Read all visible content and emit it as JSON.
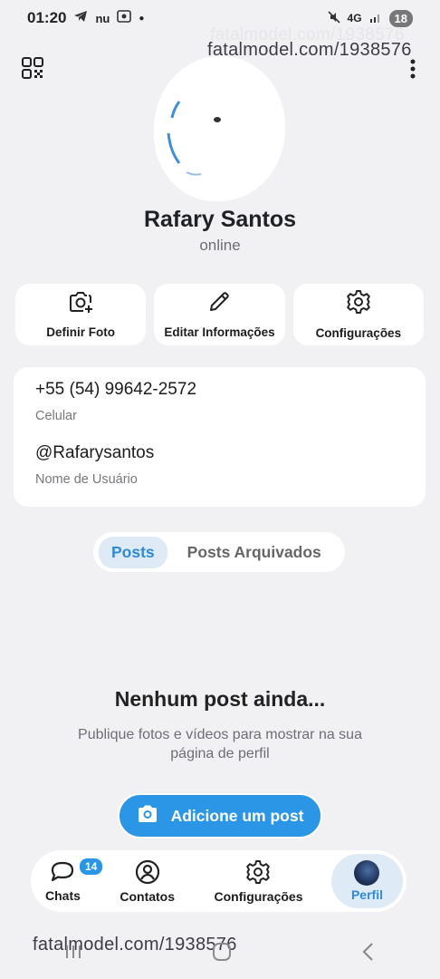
{
  "status_bar": {
    "time": "01:20",
    "network": "4G",
    "battery": "18"
  },
  "watermark": {
    "top": "fatalmodel.com/1938576",
    "top_ghost": "fatalmodel.com/1938576",
    "bottom": "fatalmodel.com/1938576"
  },
  "profile": {
    "name": "Rafary Santos",
    "status": "online"
  },
  "actions": [
    {
      "label": "Definir Foto",
      "icon": "camera-plus-icon"
    },
    {
      "label": "Editar Informações",
      "icon": "pencil-icon"
    },
    {
      "label": "Configurações",
      "icon": "gear-icon"
    }
  ],
  "info": {
    "phone": "+55 (54) 99642-2572",
    "phone_label": "Celular",
    "username": "@Rafarysantos",
    "username_label": "Nome de Usuário"
  },
  "tabs": [
    {
      "label": "Posts",
      "active": true
    },
    {
      "label": "Posts Arquivados",
      "active": false
    }
  ],
  "empty_state": {
    "title": "Nenhum post ainda...",
    "text": "Publique fotos e vídeos para mostrar na sua página de perfil",
    "button": "Adicione um post"
  },
  "bottom_nav": [
    {
      "label": "Chats",
      "badge": "14",
      "icon": "chat-icon"
    },
    {
      "label": "Contatos",
      "icon": "contact-icon"
    },
    {
      "label": "Configurações",
      "icon": "gear-icon"
    },
    {
      "label": "Perfil",
      "active": true,
      "icon": "avatar"
    }
  ],
  "colors": {
    "accent": "#2c96e6",
    "background": "#f1f1f4"
  }
}
